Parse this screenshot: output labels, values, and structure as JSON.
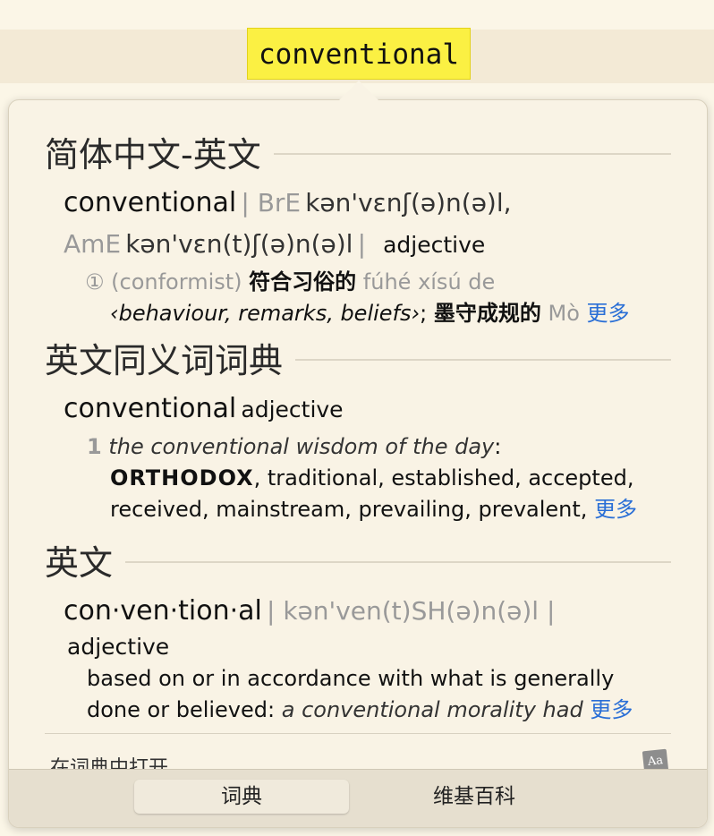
{
  "lookup_word": "conventional",
  "sections": {
    "s1": {
      "title": "简体中文-英文",
      "headword": "conventional",
      "bre_label": "| BrE",
      "bre_phon": "kən'vɛnʃ(ə)n(ə)l,",
      "ame_label": "AmE",
      "ame_phon": "kən'vɛn(t)ʃ(ə)n(ə)l",
      "bar_end": "|",
      "pos": "adjective",
      "sense_num": "①",
      "sense_label": "(conformist)",
      "sense_cn": "符合习俗的",
      "sense_pinyin": "fúhé xísú de",
      "context": "‹behaviour, remarks, beliefs›",
      "sep": ";",
      "cn2": "墨守成规的",
      "pinyin2": "Mò",
      "more": "更多"
    },
    "s2": {
      "title": "英文同义词词典",
      "headword": "conventional",
      "pos": "adjective",
      "num": "1",
      "example": "the conventional wisdom of the day",
      "colon": ":",
      "syn_main": "ORTHODOX",
      "syn_line1": ", traditional, established, accepted,",
      "syn_line2": "received, mainstream, prevailing, prevalent,",
      "more": "更多"
    },
    "s3": {
      "title": "英文",
      "headword": "con·ven·tion·al",
      "phon": "| kən'ven(t)SH(ə)n(ə)l |",
      "pos": "adjective",
      "def_line1": "based on or in accordance with what is generally",
      "def_line2": "done or believed:",
      "example": "a conventional morality had",
      "more": "更多"
    }
  },
  "footer": {
    "open_in_dictionary": "在词典中打开",
    "icon_text": "Aa"
  },
  "tabs": [
    {
      "label": "词典",
      "active": true
    },
    {
      "label": "维基百科",
      "active": false
    }
  ]
}
